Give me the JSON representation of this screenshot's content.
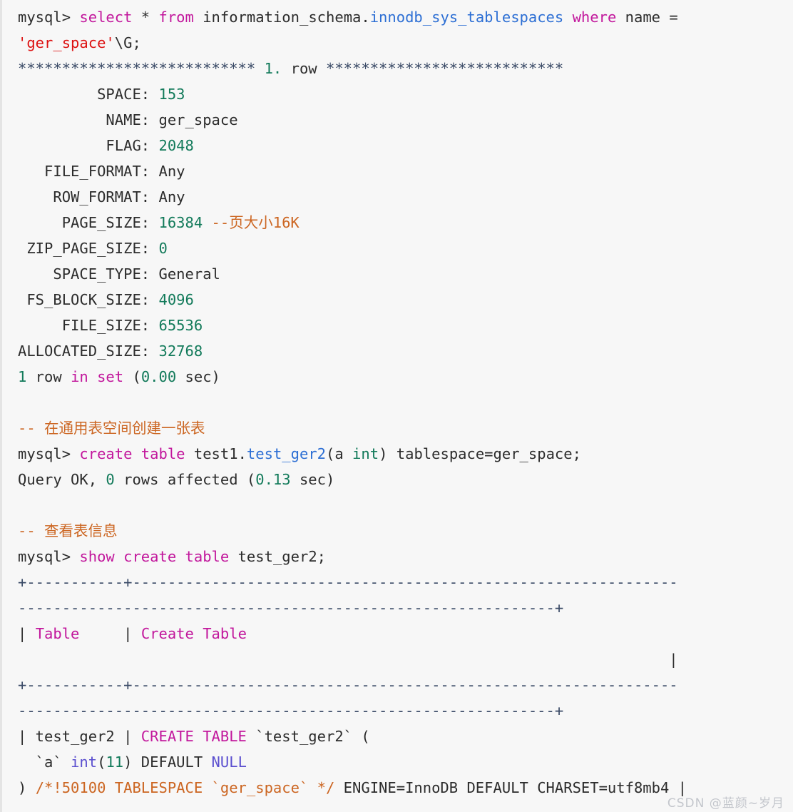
{
  "terminal": {
    "prompt": "mysql>",
    "watermark": "CSDN @蓝颜~岁月",
    "colors": {
      "background": "#f7f7f7",
      "default_text": "#2c2c2c",
      "keyword": "#c2179c",
      "number": "#127a5a",
      "string": "#dd1111",
      "identifier": "#2d6fd4",
      "comment": "#cc6622",
      "type": "#5b4fcf",
      "watermark": "#c3c6cc"
    },
    "lines": {
      "l01_a": "mysql> ",
      "l01_b": "select",
      "l01_c": " * ",
      "l01_d": "from",
      "l01_e": " information_schema.",
      "l01_f": "innodb_sys_tablespaces",
      "l01_g": " ",
      "l01_h": "where",
      "l01_i": " name =",
      "l02_a": "'ger_space'",
      "l02_b": "\\G;",
      "l03_a": "*************************** ",
      "l03_b": "1.",
      "l03_c": " row ",
      "l03_d": "***************************",
      "l04_label": "         SPACE: ",
      "l04_value": "153",
      "l05_label": "          NAME: ",
      "l05_value": "ger_space",
      "l06_label": "          FLAG: ",
      "l06_value": "2048",
      "l07_label": "   FILE_FORMAT: ",
      "l07_value": "Any",
      "l08_label": "    ROW_FORMAT: ",
      "l08_value": "Any",
      "l09_label": "     PAGE_SIZE: ",
      "l09_value": "16384",
      "l09_comment": " --页大小16K",
      "l10_label": " ZIP_PAGE_SIZE: ",
      "l10_value": "0",
      "l11_label": "    SPACE_TYPE: ",
      "l11_value": "General",
      "l12_label": " FS_BLOCK_SIZE: ",
      "l12_value": "4096",
      "l13_label": "     FILE_SIZE: ",
      "l13_value": "65536",
      "l14_label": "ALLOCATED_SIZE: ",
      "l14_value": "32768",
      "l15_a": "1",
      "l15_b": " row ",
      "l15_c": "in set",
      "l15_d": " (",
      "l15_e": "0.00",
      "l15_f": " sec)",
      "l16_comment": "-- 在通用表空间创建一张表",
      "l17_a": "mysql> ",
      "l17_b": "create table",
      "l17_c": " test1.",
      "l17_d": "test_ger2",
      "l17_e": "(a ",
      "l17_f": "int",
      "l17_g": ") tablespace=ger_space;",
      "l18_a": "Query OK, ",
      "l18_b": "0",
      "l18_c": " rows affected (",
      "l18_d": "0.13",
      "l18_e": " sec)",
      "l19_comment": "-- 查看表信息",
      "l20_a": "mysql> ",
      "l20_b": "show create table",
      "l20_c": " test_ger2;",
      "l21_sep": "+-----------+--------------------------------------------------------------",
      "l22_sep": "-------------------------------------------------------------+",
      "l23_a": "| ",
      "l23_b": "Table",
      "l23_c": "     | ",
      "l23_d": "Create Table",
      "l24_pipe": "                                                                          |",
      "l25_sep": "+-----------+--------------------------------------------------------------",
      "l26_sep": "-------------------------------------------------------------+",
      "l27_a": "| test_ger2 | ",
      "l27_b": "CREATE TABLE",
      "l27_c": " `test_ger2` (",
      "l28_a": "  `a` ",
      "l28_b": "int",
      "l28_c": "(",
      "l28_d": "11",
      "l28_e": ") DEFAULT ",
      "l28_f": "NULL",
      "l29_a": ") ",
      "l29_b": "/*!50100 TABLESPACE `ger_space` */",
      "l29_c": " ENGINE=InnoDB DEFAULT CHARSET=utf8mb4 |"
    }
  }
}
